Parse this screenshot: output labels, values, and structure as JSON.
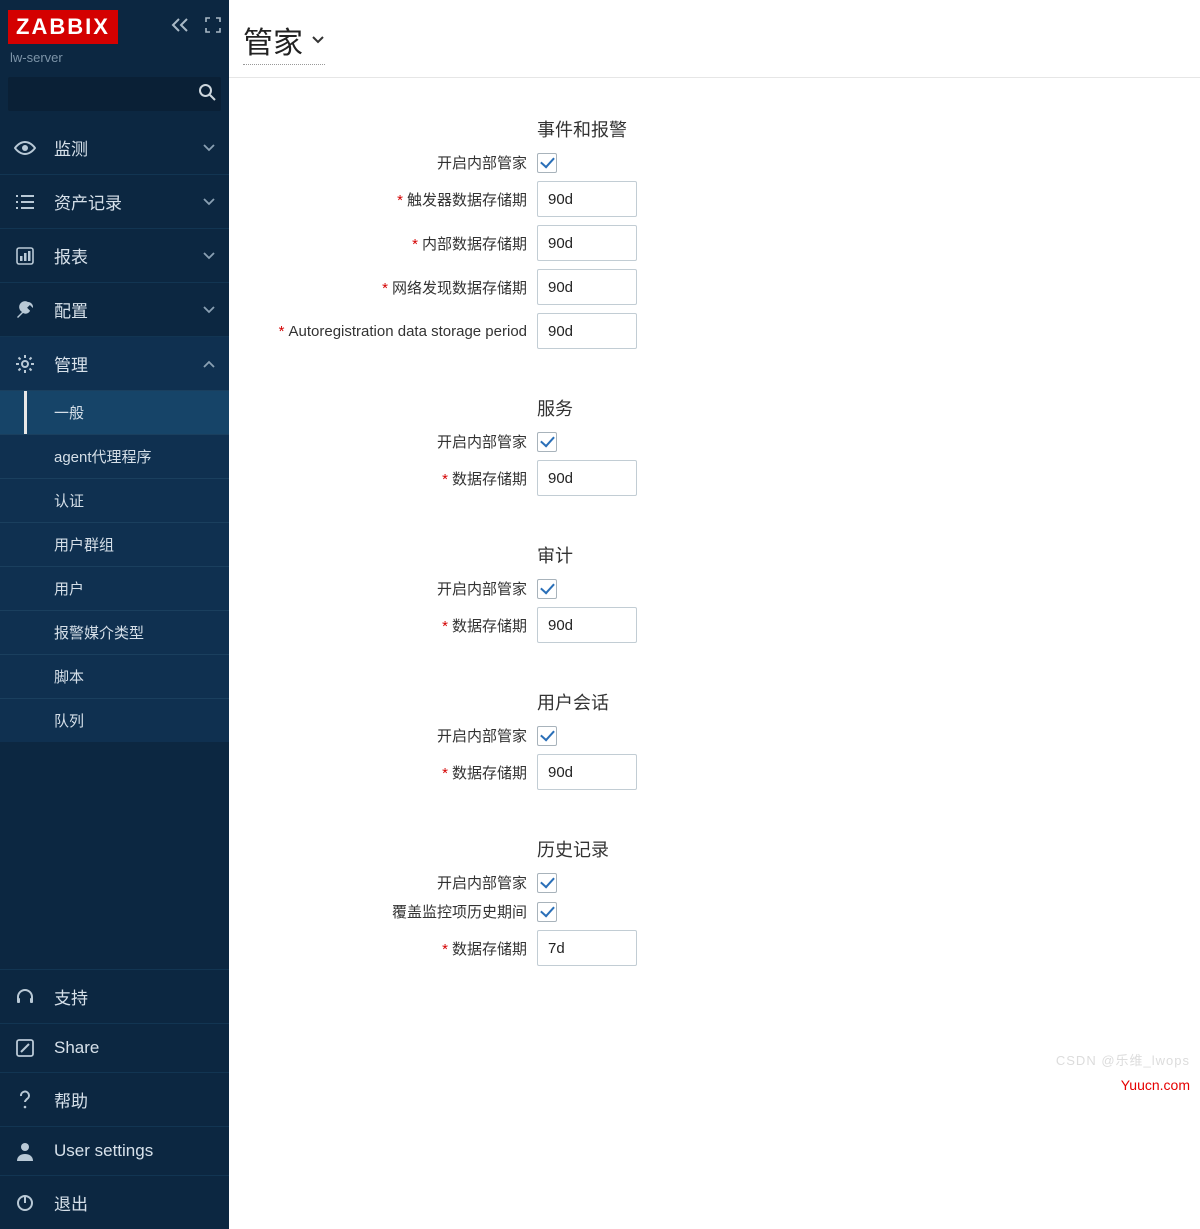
{
  "header": {
    "logo": "ZABBIX",
    "server_name": "lw-server",
    "page_title": "管家"
  },
  "sidebar": {
    "items": [
      {
        "label": "监测",
        "icon": "eye",
        "expanded": false
      },
      {
        "label": "资产记录",
        "icon": "list",
        "expanded": false
      },
      {
        "label": "报表",
        "icon": "barchart",
        "expanded": false
      },
      {
        "label": "配置",
        "icon": "wrench",
        "expanded": false
      },
      {
        "label": "管理",
        "icon": "gear",
        "expanded": true,
        "children": [
          {
            "label": "一般",
            "selected": true
          },
          {
            "label": "agent代理程序"
          },
          {
            "label": "认证"
          },
          {
            "label": "用户群组"
          },
          {
            "label": "用户"
          },
          {
            "label": "报警媒介类型"
          },
          {
            "label": "脚本"
          },
          {
            "label": "队列"
          }
        ]
      }
    ],
    "bottom": [
      {
        "label": "支持",
        "icon": "headset"
      },
      {
        "label": "Share",
        "icon": "zshare"
      },
      {
        "label": "帮助",
        "icon": "question"
      },
      {
        "label": "User settings",
        "icon": "user"
      },
      {
        "label": "退出",
        "icon": "power"
      }
    ]
  },
  "form": {
    "s1": {
      "title": "事件和报警",
      "enable_label": "开启内部管家",
      "enable": true,
      "f1_label": "触发器数据存储期",
      "f1_value": "90d",
      "f2_label": "内部数据存储期",
      "f2_value": "90d",
      "f3_label": "网络发现数据存储期",
      "f3_value": "90d",
      "f4_label": "Autoregistration data storage period",
      "f4_value": "90d"
    },
    "s2": {
      "title": "服务",
      "enable_label": "开启内部管家",
      "enable": true,
      "f1_label": "数据存储期",
      "f1_value": "90d"
    },
    "s3": {
      "title": "审计",
      "enable_label": "开启内部管家",
      "enable": true,
      "f1_label": "数据存储期",
      "f1_value": "90d"
    },
    "s4": {
      "title": "用户会话",
      "enable_label": "开启内部管家",
      "enable": true,
      "f1_label": "数据存储期",
      "f1_value": "90d"
    },
    "s5": {
      "title": "历史记录",
      "enable_label": "开启内部管家",
      "enable": true,
      "override_label": "覆盖监控项历史期间",
      "override": true,
      "f1_label": "数据存储期",
      "f1_value": "7d"
    }
  },
  "watermarks": {
    "csdn": "CSDN @乐维_lwops",
    "yuucn": "Yuucn.com"
  }
}
